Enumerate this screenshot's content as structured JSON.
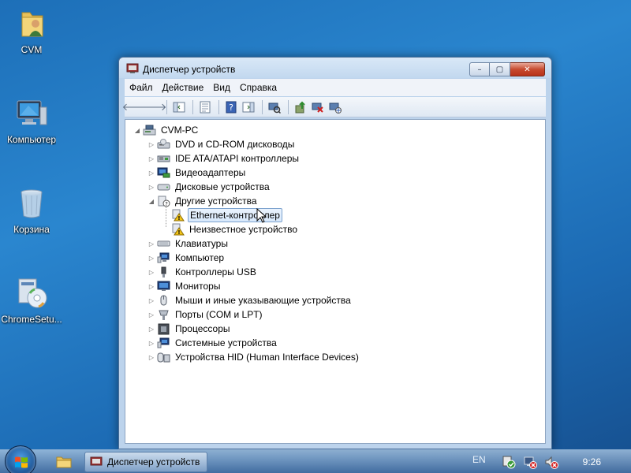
{
  "desktop": {
    "icons": [
      {
        "label": "CVM"
      },
      {
        "label": "Компьютер"
      },
      {
        "label": "Корзина"
      },
      {
        "label": "ChromeSetu..."
      }
    ]
  },
  "window": {
    "title": "Диспетчер устройств",
    "caption": {
      "minimize": "–",
      "maximize": "▢",
      "close": "✕"
    },
    "menu": [
      "Файл",
      "Действие",
      "Вид",
      "Справка"
    ],
    "toolbar": {
      "back": "🡐",
      "forward": "🡒"
    },
    "tree": {
      "root": "CVM-PC",
      "items": [
        {
          "label": "DVD и CD-ROM дисководы"
        },
        {
          "label": "IDE ATA/ATAPI контроллеры"
        },
        {
          "label": "Видеоадаптеры"
        },
        {
          "label": "Дисковые устройства"
        },
        {
          "label": "Другие устройства"
        },
        {
          "label": "Ethernet-контроллер"
        },
        {
          "label": "Неизвестное устройство"
        },
        {
          "label": "Клавиатуры"
        },
        {
          "label": "Компьютер"
        },
        {
          "label": "Контроллеры USB"
        },
        {
          "label": "Мониторы"
        },
        {
          "label": "Мыши и иные указывающие устройства"
        },
        {
          "label": "Порты (COM и LPT)"
        },
        {
          "label": "Процессоры"
        },
        {
          "label": "Системные устройства"
        },
        {
          "label": "Устройства HID (Human Interface Devices)"
        }
      ]
    }
  },
  "taskbar": {
    "task_label": "Диспетчер устройств",
    "language": "EN",
    "clock": "9:26"
  }
}
